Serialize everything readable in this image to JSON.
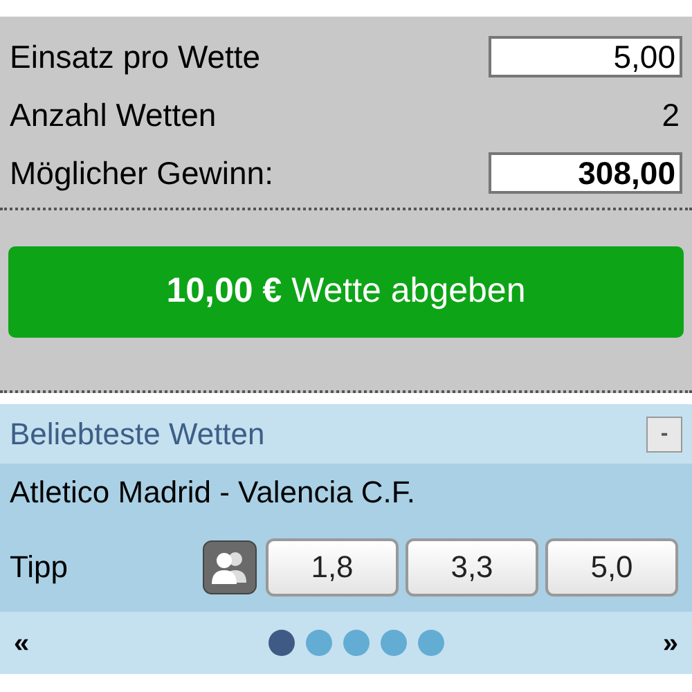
{
  "stake": {
    "label": "Einsatz pro Wette",
    "value": "5,00"
  },
  "count": {
    "label": "Anzahl Wetten",
    "value": "2"
  },
  "winnings": {
    "label": "Möglicher Gewinn:",
    "value": "308,00"
  },
  "submit_button": "**10,00 €** Wette abgeben",
  "popular": {
    "title": "Beliebteste Wetten",
    "collapse": "-",
    "match": "Atletico Madrid - Valencia C.F.",
    "tip_label": "Tipp",
    "odds": [
      "1,8",
      "3,3",
      "5,0"
    ],
    "prev": "«",
    "next": "»",
    "pages": [
      {
        "selected": true
      },
      {
        "selected": false
      },
      {
        "selected": false
      },
      {
        "selected": false
      },
      {
        "selected": false
      }
    ]
  }
}
